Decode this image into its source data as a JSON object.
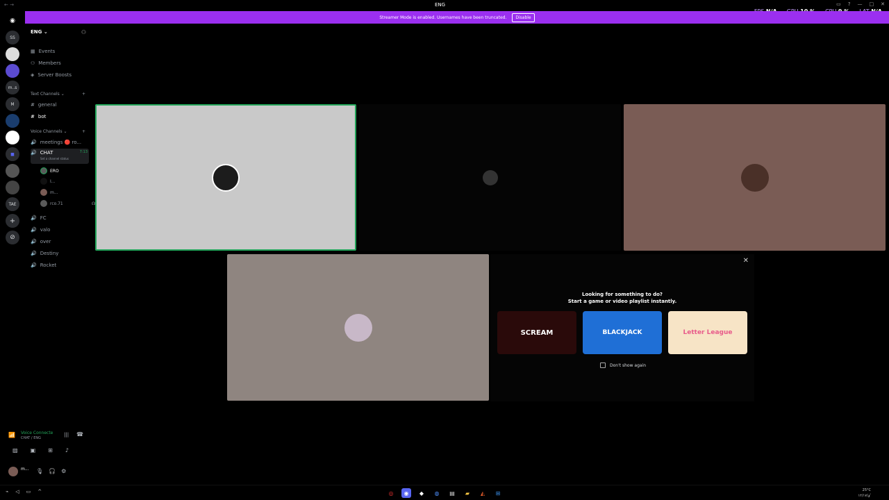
{
  "window": {
    "title": "ENG",
    "nav": "←  →"
  },
  "overlay": {
    "fps_label": "FPS",
    "fps_value": "N/A",
    "gpu_label": "GPU",
    "gpu_value": "10 %",
    "cpu_label": "CPU",
    "cpu_value": "9 %",
    "lat_label": "LAT",
    "lat_value": "N/A"
  },
  "banner": {
    "text": "Streamer Mode is enabled. Usernames have been truncated.",
    "button": "Disable"
  },
  "rail": {
    "servers": [
      "SS",
      "",
      "",
      "m..s",
      "M",
      "",
      "",
      "",
      "",
      "",
      "TAE"
    ]
  },
  "sidebar": {
    "server_name": "ENG",
    "items": [
      {
        "label": "Events",
        "icon": "calendar-icon"
      },
      {
        "label": "Members",
        "icon": "members-icon"
      },
      {
        "label": "Server Boosts",
        "icon": "boost-icon"
      }
    ],
    "text_category": "Text Channels",
    "text_channels": [
      "general",
      "bot"
    ],
    "voice_category": "Voice Channels",
    "voice_channels": [
      {
        "label": "meetings 🔴 ro..."
      },
      {
        "label": "CHAT",
        "time": "7:13",
        "status": "Set a channel status"
      }
    ],
    "voice_users": [
      "ERO",
      "I...",
      "m...",
      "rco.71"
    ],
    "other_channels": [
      "FC",
      "valo",
      "over",
      "Destiny",
      "Rocket"
    ]
  },
  "voice_panel": {
    "title": "Voice Connecte",
    "subtitle": "CHAT / ENG",
    "user": "m..."
  },
  "promo": {
    "line1": "Looking for something to do?",
    "line2": "Start a game or video playlist instantly.",
    "games": [
      "SCREAM",
      "BLACKJACK",
      "Letter League"
    ],
    "dont_show": "Don't show again"
  },
  "taskbar": {
    "weather": "25°C",
    "date": "ٴٶ/١٢/١٧"
  },
  "colors": {
    "banner": "#9b2ff0",
    "speaking": "#23a55a",
    "tile1": "#c9c9c9",
    "tile3": "#7a5c55",
    "tile4": "#8f8580"
  }
}
